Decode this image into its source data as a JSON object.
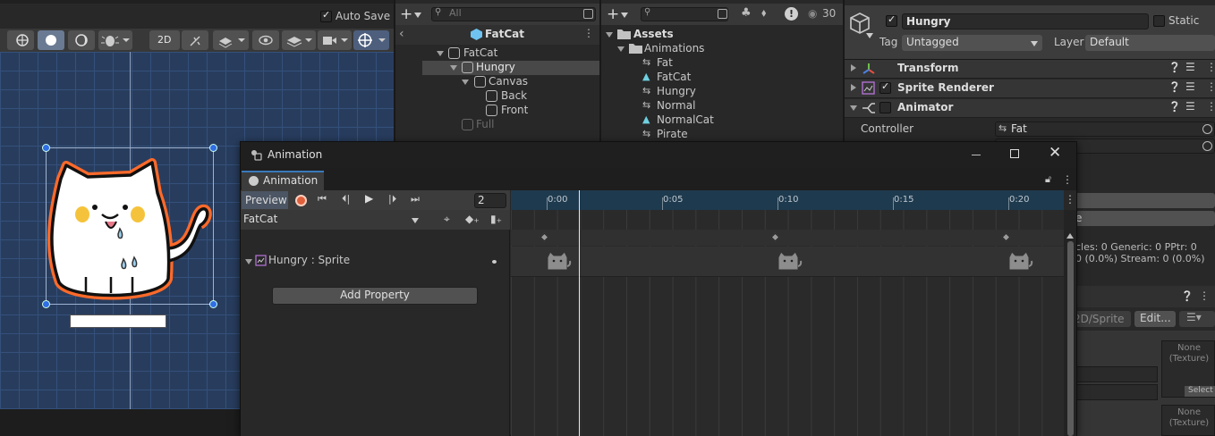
{
  "scene": {
    "auto_save_label": "Auto Save",
    "btn_2d": "2D"
  },
  "hierarchy": {
    "search_placeholder": "All",
    "scene_title": "FatCat",
    "items": [
      {
        "label": "FatCat"
      },
      {
        "label": "Hungry"
      },
      {
        "label": "Canvas"
      },
      {
        "label": "Back"
      },
      {
        "label": "Front"
      },
      {
        "label": "Full"
      }
    ]
  },
  "project": {
    "visible_count": "30",
    "root": "Assets",
    "folder": "Animations",
    "files": [
      {
        "label": "Fat"
      },
      {
        "label": "FatCat"
      },
      {
        "label": "Hungry"
      },
      {
        "label": "Normal"
      },
      {
        "label": "NormalCat"
      },
      {
        "label": "Pirate"
      }
    ]
  },
  "inspector": {
    "object_name": "Hungry",
    "static_label": "Static",
    "tag_label": "Tag",
    "tag_value": "Untagged",
    "layer_label": "Layer",
    "layer_value": "Default",
    "components": [
      {
        "label": "Transform"
      },
      {
        "label": "Sprite Renderer"
      },
      {
        "label": "Animator"
      }
    ],
    "controller_label": "Controller",
    "controller_value": "Fat",
    "partial_e": "e",
    "stats_line1": "cles: 0 Generic: 0 PPtr: 0",
    "stats_line2": "0 (0.0%) Stream: 0 (0.0%)",
    "sprite_shader": "2D/Sprite",
    "edit_label": "Edit...",
    "none_texture_1": "None\n(Texture)",
    "none_texture_2": "None\n(Texture)",
    "select_label": "Select"
  },
  "animation": {
    "window_title": "Animation",
    "tab_label": "Animation",
    "preview_label": "Preview",
    "frame_value": "2",
    "clip_name": "FatCat",
    "property_label": "Hungry : Sprite",
    "add_property_label": "Add Property",
    "time_labels": [
      "0:00",
      "0:05",
      "0:10",
      "0:15",
      "0:20"
    ]
  },
  "colors": {
    "scene_bg": "#283d5e",
    "timeline_header": "#1e3a4e",
    "record_red": "#e0603c",
    "cat_outline": "#ff6a2a"
  }
}
